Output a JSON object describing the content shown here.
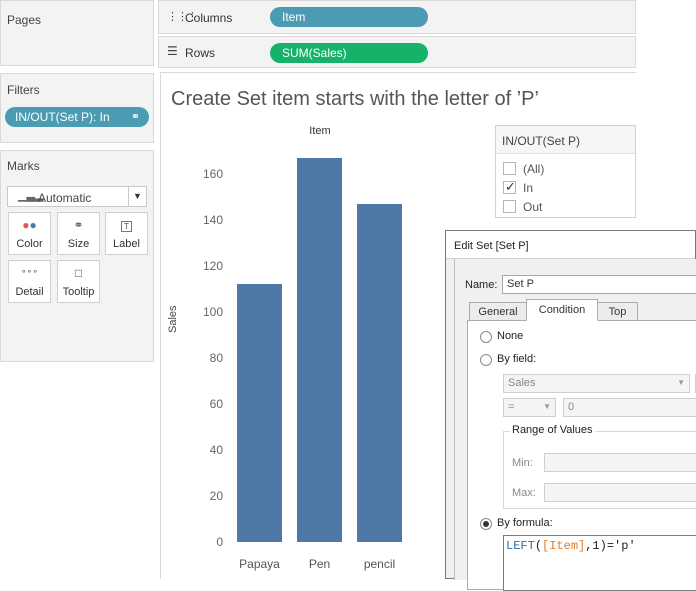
{
  "left": {
    "pages_title": "Pages",
    "filters_title": "Filters",
    "filter_pill": "IN/OUT(Set P): In",
    "marks_title": "Marks",
    "mark_type": "Automatic",
    "cards": [
      {
        "label": "Color",
        "icon": "color-icon"
      },
      {
        "label": "Size",
        "icon": "size-icon"
      },
      {
        "label": "Label",
        "icon": "label-icon"
      },
      {
        "label": "Detail",
        "icon": "detail-icon"
      },
      {
        "label": "Tooltip",
        "icon": "tooltip-icon"
      }
    ]
  },
  "shelves": {
    "columns_label": "Columns",
    "columns_pill": "Item",
    "rows_label": "Rows",
    "rows_pill": "SUM(Sales)"
  },
  "colors": {
    "bar": "#4e79a7",
    "dimension_pill": "#4b9cb3",
    "measure_pill": "#17b26a"
  },
  "view": {
    "title": "Create Set item starts with the letter of ’P’"
  },
  "chart_data": {
    "type": "bar",
    "title": "Item",
    "categories": [
      "Papaya",
      "Pen",
      "pencil"
    ],
    "values": [
      112,
      167,
      147
    ],
    "xlabel": "",
    "ylabel": "Sales",
    "ylim": [
      0,
      172
    ],
    "yticks": [
      "0",
      "20",
      "40",
      "60",
      "80",
      "100",
      "120",
      "140",
      "160"
    ],
    "grid": false
  },
  "filter_card": {
    "title": "IN/OUT(Set P)",
    "options": [
      {
        "label": "(All)",
        "checked": false
      },
      {
        "label": "In",
        "checked": true
      },
      {
        "label": "Out",
        "checked": false
      }
    ]
  },
  "dialog": {
    "title": "Edit Set [Set P]",
    "name_label": "Name:",
    "name_value": "Set P",
    "tabs": [
      "General",
      "Condition",
      "Top"
    ],
    "active_tab": "Condition",
    "none_label": "None",
    "by_field_label": "By field:",
    "field_select": "Sales",
    "operator": "=",
    "value": "0",
    "range_title": "Range of Values",
    "min_label": "Min:",
    "max_label": "Max:",
    "by_formula_label": "By formula:",
    "formula_func": "LEFT",
    "formula_field": "[Item]",
    "formula_rest": ",1)='p'"
  }
}
